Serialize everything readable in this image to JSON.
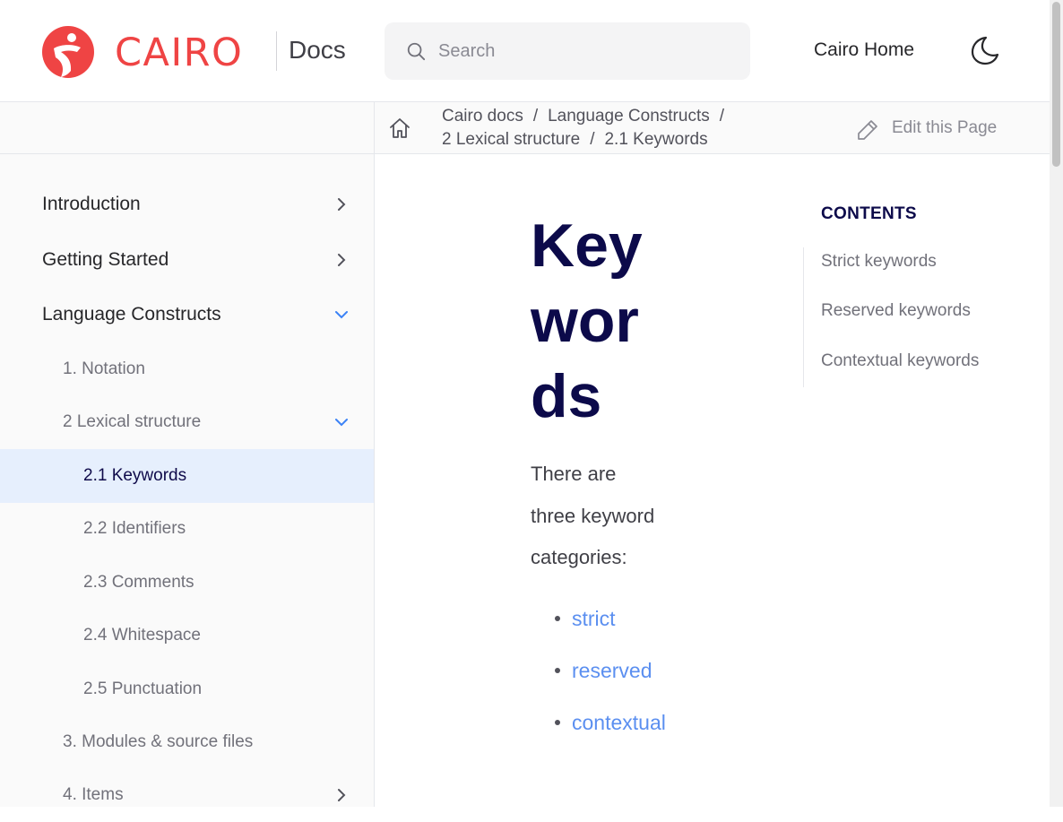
{
  "header": {
    "logo_text": "CAIRO",
    "docs_label": "Docs",
    "search_placeholder": "Search",
    "home_link": "Cairo Home",
    "theme_icon": "moon-icon",
    "brand_color": "#ef4444"
  },
  "breadcrumb": {
    "items": [
      "Cairo docs",
      "Language Constructs",
      "2 Lexical structure",
      "2.1 Keywords"
    ],
    "edit_label": "Edit this Page"
  },
  "sidebar": {
    "items": [
      {
        "label": "Introduction",
        "level": 1,
        "chevron": "right"
      },
      {
        "label": "Getting Started",
        "level": 1,
        "chevron": "right"
      },
      {
        "label": "Language Constructs",
        "level": 1,
        "chevron": "down"
      },
      {
        "label": "1. Notation",
        "level": 2,
        "chevron": "none"
      },
      {
        "label": "2 Lexical structure",
        "level": 2,
        "chevron": "down"
      },
      {
        "label": "2.1 Keywords",
        "level": 3,
        "chevron": "none",
        "active": true
      },
      {
        "label": "2.2 Identifiers",
        "level": 3,
        "chevron": "none"
      },
      {
        "label": "2.3 Comments",
        "level": 3,
        "chevron": "none"
      },
      {
        "label": "2.4 Whitespace",
        "level": 3,
        "chevron": "none"
      },
      {
        "label": "2.5 Punctuation",
        "level": 3,
        "chevron": "none"
      },
      {
        "label": "3. Modules & source files",
        "level": 2,
        "chevron": "none"
      },
      {
        "label": "4. Items",
        "level": 2,
        "chevron": "right"
      }
    ],
    "active_bg": "#e6effd"
  },
  "article": {
    "title_lines": [
      "Key",
      "wor",
      "ds"
    ],
    "intro_lines": [
      "There are",
      "three keyword",
      "categories:"
    ],
    "links": [
      "strict",
      "reserved",
      "contextual"
    ],
    "link_color": "#5b8ff0"
  },
  "toc": {
    "title": "CONTENTS",
    "items": [
      "Strict keywords",
      "Reserved keywords",
      "Contextual keywords"
    ]
  }
}
